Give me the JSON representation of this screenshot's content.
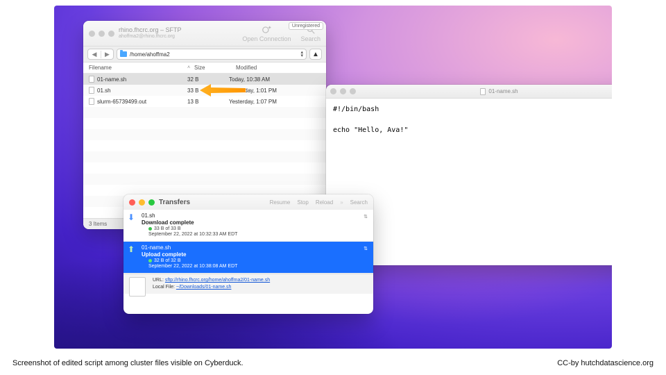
{
  "caption": {
    "left": "Screenshot of edited script among cluster files visible on Cyberduck.",
    "right": "CC-by hutchdatascience.org"
  },
  "cyberduck": {
    "title": "rhino.fhcrc.org – SFTP",
    "subtitle": "ahoffma2@rhino.fhcrc.org",
    "unregistered": "Unregistered",
    "toolbar": {
      "open": "Open Connection",
      "search": "Search"
    },
    "path": "/home/ahoffma2",
    "columns": {
      "name": "Filename",
      "size": "Size",
      "modified": "Modified"
    },
    "rows": [
      {
        "name": "01-name.sh",
        "size": "32 B",
        "modified": "Today, 10:38 AM",
        "selected": true
      },
      {
        "name": "01.sh",
        "size": "33 B",
        "modified": "Yesterday, 1:01 PM",
        "selected": false
      },
      {
        "name": "slurm-65739499.out",
        "size": "13 B",
        "modified": "Yesterday, 1:07 PM",
        "selected": false
      }
    ],
    "status": "3 Items"
  },
  "editor": {
    "title": "01-name.sh",
    "content": "#!/bin/bash\n\necho \"Hello, Ava!\""
  },
  "transfers": {
    "title": "Transfers",
    "cmds": {
      "resume": "Resume",
      "stop": "Stop",
      "reload": "Reload",
      "search": "Search"
    },
    "items": [
      {
        "dir": "down",
        "name": "01.sh",
        "status": "Download complete",
        "bytes": "33 B of 33 B",
        "time": "September 22, 2022 at 10:32:33 AM EDT",
        "selected": false
      },
      {
        "dir": "up",
        "name": "01-name.sh",
        "status": "Upload complete",
        "bytes": "32 B of 32 B",
        "time": "September 22, 2022 at 10:38:08 AM EDT",
        "selected": true
      }
    ],
    "footer": {
      "url_label": "URL:",
      "url": "sftp://rhino.fhcrc.org/home/ahoffma2/01-name.sh",
      "local_label": "Local File:",
      "local": "~/Downloads/01-name.sh"
    }
  }
}
